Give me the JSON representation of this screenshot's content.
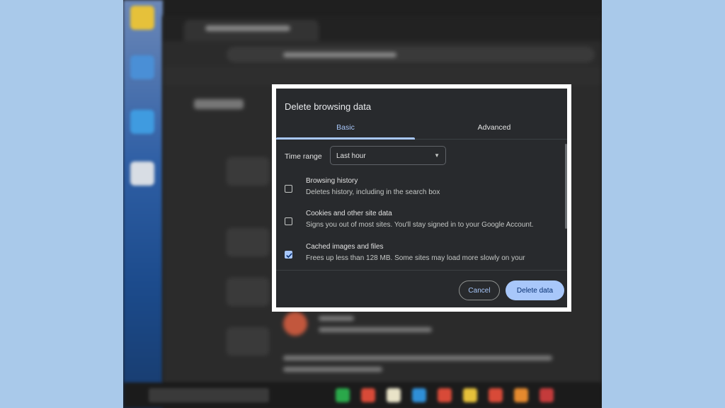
{
  "dialog": {
    "title": "Delete browsing data",
    "tabs": [
      {
        "label": "Basic",
        "active": true
      },
      {
        "label": "Advanced",
        "active": false
      }
    ],
    "time_range": {
      "label": "Time range",
      "selected": "Last hour"
    },
    "options": [
      {
        "title": "Browsing history",
        "description": "Deletes history, including in the search box",
        "checked": false
      },
      {
        "title": "Cookies and other site data",
        "description": "Signs you out of most sites. You'll stay signed in to your Google Account.",
        "checked": false
      },
      {
        "title": "Cached images and files",
        "description": "Frees up less than 128 MB. Some sites may load more slowly on your",
        "checked": true
      }
    ],
    "buttons": {
      "cancel": "Cancel",
      "delete": "Delete data"
    }
  },
  "colors": {
    "dialog_bg": "#282a2d",
    "accent": "#a8c7fa",
    "frame": "#ffffff",
    "page_bg": "#a9c9ea"
  }
}
